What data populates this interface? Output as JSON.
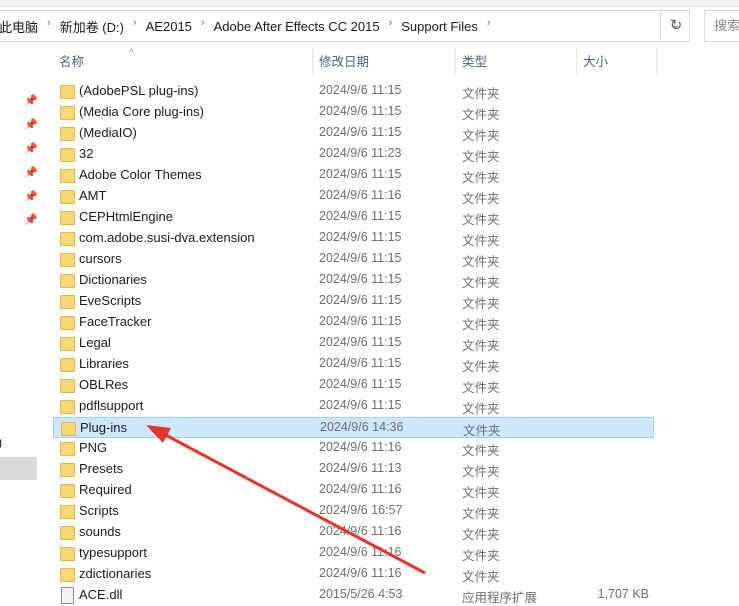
{
  "breadcrumb": [
    "此电脑",
    "新加卷 (D:)",
    "AE2015",
    "Adobe After Effects CC 2015",
    "Support Files"
  ],
  "search_placeholder": "搜索",
  "columns": {
    "name": "名称",
    "date": "修改日期",
    "type": "类型",
    "size": "大小"
  },
  "left_pane_fragment": ")",
  "rows": [
    {
      "name": "(AdobePSL plug-ins)",
      "date": "2024/9/6 11:15",
      "type": "文件夹",
      "size": ""
    },
    {
      "name": "(Media Core plug-ins)",
      "date": "2024/9/6 11:15",
      "type": "文件夹",
      "size": ""
    },
    {
      "name": "(MediaIO)",
      "date": "2024/9/6 11:15",
      "type": "文件夹",
      "size": ""
    },
    {
      "name": "32",
      "date": "2024/9/6 11:23",
      "type": "文件夹",
      "size": ""
    },
    {
      "name": "Adobe Color Themes",
      "date": "2024/9/6 11:15",
      "type": "文件夹",
      "size": ""
    },
    {
      "name": "AMT",
      "date": "2024/9/6 11:16",
      "type": "文件夹",
      "size": ""
    },
    {
      "name": "CEPHtmlEngine",
      "date": "2024/9/6 11:15",
      "type": "文件夹",
      "size": ""
    },
    {
      "name": "com.adobe.susi-dva.extension",
      "date": "2024/9/6 11:15",
      "type": "文件夹",
      "size": ""
    },
    {
      "name": "cursors",
      "date": "2024/9/6 11:15",
      "type": "文件夹",
      "size": ""
    },
    {
      "name": "Dictionaries",
      "date": "2024/9/6 11:15",
      "type": "文件夹",
      "size": ""
    },
    {
      "name": "EveScripts",
      "date": "2024/9/6 11:15",
      "type": "文件夹",
      "size": ""
    },
    {
      "name": "FaceTracker",
      "date": "2024/9/6 11:15",
      "type": "文件夹",
      "size": ""
    },
    {
      "name": "Legal",
      "date": "2024/9/6 11:15",
      "type": "文件夹",
      "size": ""
    },
    {
      "name": "Libraries",
      "date": "2024/9/6 11:15",
      "type": "文件夹",
      "size": ""
    },
    {
      "name": "OBLRes",
      "date": "2024/9/6 11:15",
      "type": "文件夹",
      "size": ""
    },
    {
      "name": "pdflsupport",
      "date": "2024/9/6 11:15",
      "type": "文件夹",
      "size": ""
    },
    {
      "name": "Plug-ins",
      "date": "2024/9/6 14:36",
      "type": "文件夹",
      "size": "",
      "selected": true
    },
    {
      "name": "PNG",
      "date": "2024/9/6 11:16",
      "type": "文件夹",
      "size": ""
    },
    {
      "name": "Presets",
      "date": "2024/9/6 11:13",
      "type": "文件夹",
      "size": ""
    },
    {
      "name": "Required",
      "date": "2024/9/6 11:16",
      "type": "文件夹",
      "size": ""
    },
    {
      "name": "Scripts",
      "date": "2024/9/6 16:57",
      "type": "文件夹",
      "size": ""
    },
    {
      "name": "sounds",
      "date": "2024/9/6 11:16",
      "type": "文件夹",
      "size": ""
    },
    {
      "name": "typesupport",
      "date": "2024/9/6 11:16",
      "type": "文件夹",
      "size": ""
    },
    {
      "name": "zdictionaries",
      "date": "2024/9/6 11:16",
      "type": "文件夹",
      "size": ""
    },
    {
      "name": "ACE.dll",
      "date": "2015/5/26 4:53",
      "type": "应用程序扩展",
      "size": "1,707 KB",
      "file": true
    }
  ]
}
